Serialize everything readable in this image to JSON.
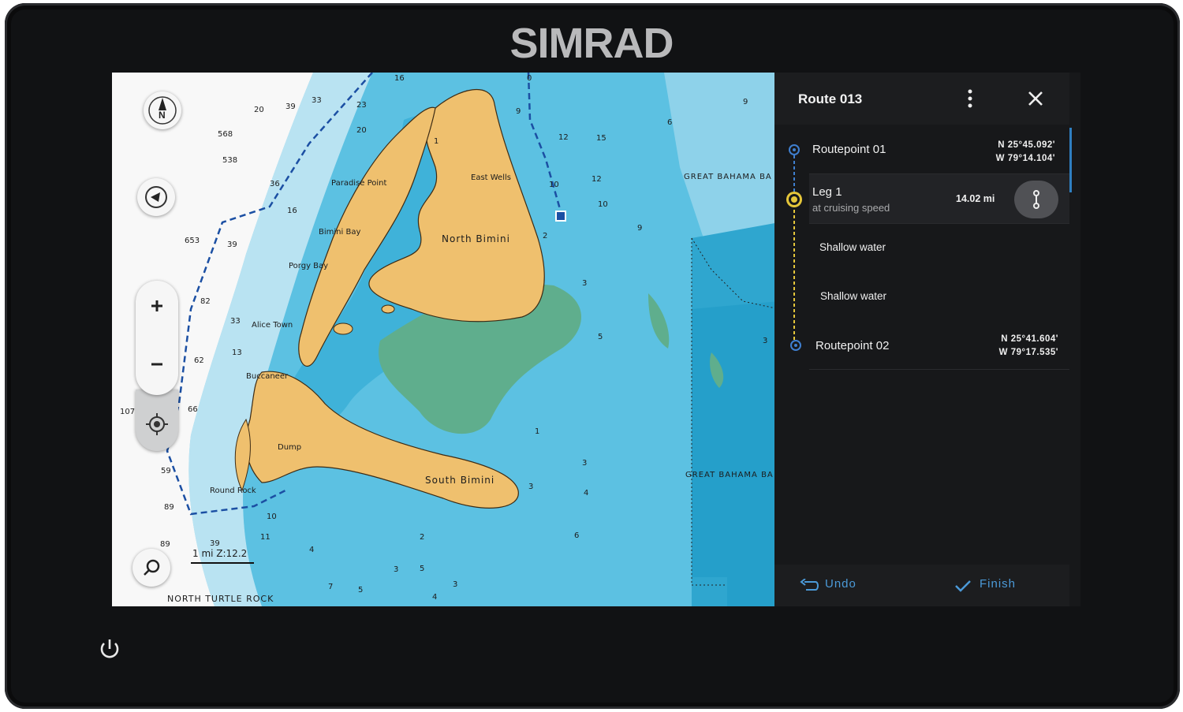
{
  "device": {
    "brand": "SIMRAD"
  },
  "route_panel": {
    "title": "Route 013",
    "items": [
      {
        "label": "Routepoint 01",
        "lat": "N 25°45.092'",
        "lon": "W 79°14.104'"
      },
      {
        "label": "Leg 1",
        "sub": "at cruising speed",
        "distance": "14.02 mi"
      },
      {
        "label": "Shallow water"
      },
      {
        "label": "Shallow water"
      },
      {
        "label": "Routepoint 02",
        "lat": "N 25°41.604'",
        "lon": "W 79°17.535'"
      }
    ],
    "undo_label": "Undo",
    "finish_label": "Finish"
  },
  "map": {
    "labels": {
      "north_bimini": "North Bimini",
      "south_bimini": "South Bimini",
      "east_wells": "East Wells",
      "paradise_point": "Paradise Point",
      "bimini_bay": "Bimini Bay",
      "porgy_bay": "Porgy Bay",
      "alice_town": "Alice Town",
      "buccaneer": "Buccaneer",
      "dump": "Dump",
      "round_rock": "Round Rock",
      "north_turtle_rock": "NORTH TURTLE ROCK",
      "great_bahama_1": "GREAT BAHAMA BA",
      "great_bahama_2": "GREAT BAHAMA BA",
      "scale": "1 mi Z:12.2",
      "compass_n": "N"
    },
    "depths": [
      "16",
      "20",
      "39",
      "23",
      "20",
      "33",
      "568",
      "538",
      "36",
      "16",
      "653",
      "39",
      "82",
      "33",
      "62",
      "13",
      "66",
      "107",
      "59",
      "89",
      "89",
      "39",
      "0",
      "9",
      "12",
      "15",
      "6",
      "9",
      "10",
      "12",
      "10",
      "9",
      "1",
      "2",
      "3",
      "5",
      "3",
      "1",
      "3",
      "4",
      "3",
      "6",
      "2",
      "5",
      "3",
      "7",
      "10",
      "11",
      "4",
      "5",
      "3",
      "4"
    ]
  },
  "colors": {
    "deep": "#8ecfe6",
    "mid": "#53bfe0",
    "shallow": "#2fa9d4",
    "land": "#efc06e",
    "green": "#5fb08e",
    "panel": "#17181a",
    "accent": "#4b9ad8",
    "route": "#1b4fa3"
  }
}
